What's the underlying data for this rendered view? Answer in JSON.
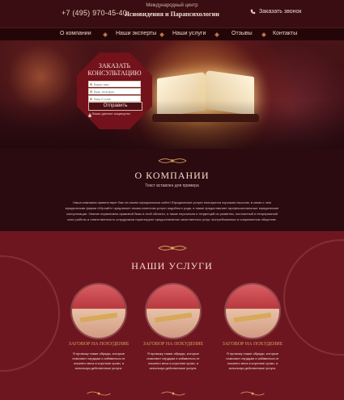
{
  "header": {
    "phone": "+7 (495) 970-45-40",
    "brand_top": "Международный центр",
    "brand_main": "Ясновидения и Парапсихологии",
    "callback_label": "Заказать звонок"
  },
  "nav": {
    "items": [
      "О компании",
      "Наши эксперты",
      "Наши услуги",
      "Отзывы",
      "Контакты"
    ]
  },
  "consult": {
    "title_line1": "ЗАКАЗАТЬ",
    "title_line2": "КОНСУЛЬТАЦИЮ",
    "inputs": [
      {
        "placeholder": "Ваше имя"
      },
      {
        "placeholder": "Ваш телефон"
      },
      {
        "placeholder": "Ваш E-mail"
      }
    ],
    "submit_label": "Отправить",
    "note": "Ваши данные защищены"
  },
  "about": {
    "title": "О КОМПАНИИ",
    "subtitle": "Текст вставлен для примера",
    "paragraph": "Наша компания приветствует Вас на своем официальном сайте! Юридические услуги пользуются хорошим спросом, в связи с чем юридическая фирма «Юрлайт» предлагает своим клиентам услуги подобного рода, а также предоставляет профессиональные юридические консультации. Знание нормативно-правовой базы в этой области, а также персонала и тенденций их развития, постоянный и непрерывный опыт работы и ответственность сотрудников гарантируют предоставление качественных услуг, востребованных в современном обществе."
  },
  "services": {
    "title": "НАШИ УСЛУГИ",
    "cards": [
      {
        "title": "ЗАГОВОР НА ПОХУДЕНИЕ",
        "text": "Я провожу также обряды, которые помогают сердцам и избавиться от лишнего веса в короткие сроки, а используя действенные услуги."
      },
      {
        "title": "ЗАГОВОР НА ПОХУДЕНИЕ",
        "text": "Я провожу также обряды, которые помогают сердцам и избавиться от лишнего веса в короткие сроки, а используя действенные услуги."
      },
      {
        "title": "ЗАГОВОР НА ПОХУДЕНИЕ",
        "text": "Я провожу также обряды, которые помогают сердцам и избавиться от лишнего веса в короткие сроки, а используя действенные услуги."
      }
    ]
  },
  "colors": {
    "accent": "#74121c",
    "gold": "#d7a45d",
    "background": "#2a0c10"
  }
}
